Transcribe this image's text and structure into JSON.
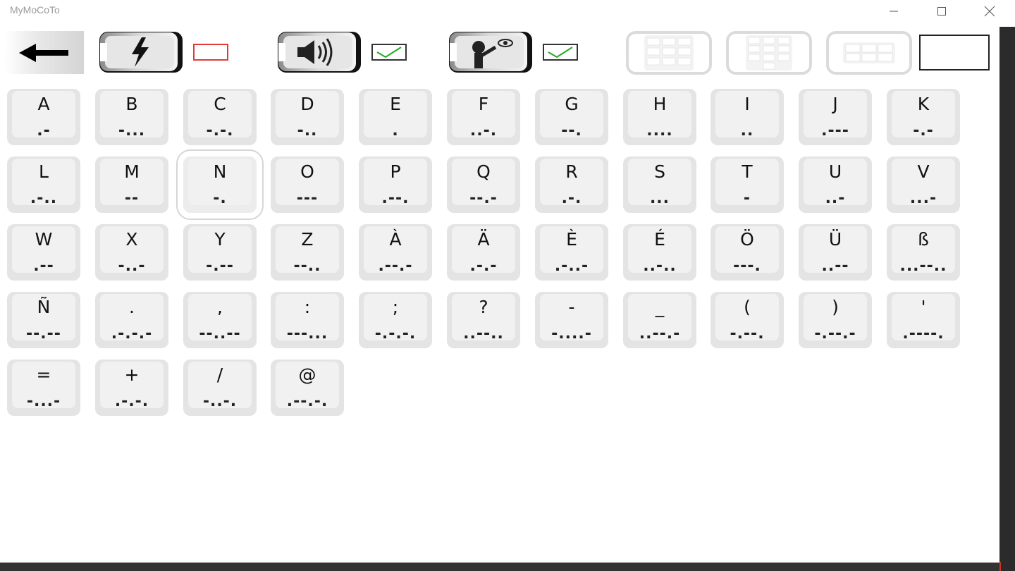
{
  "window": {
    "title": "MyMoCoTo"
  },
  "toolbar": {
    "back_icon": "left-arrow-icon",
    "flash_toggle_icon": "lightning-icon",
    "flash_checked": false,
    "sound_toggle_icon": "speaker-icon",
    "sound_checked": true,
    "visual_toggle_icon": "person-eye-icon",
    "visual_checked": true,
    "layout_icons": [
      "abc-keypad-icon",
      "numeric-keypad-icon",
      "arrow-keypad-icon"
    ],
    "colors": {
      "unchecked_border": "#e23a3a",
      "check_mark": "#22a822"
    }
  },
  "keys": [
    {
      "letter": "A",
      "code": ".-"
    },
    {
      "letter": "B",
      "code": "-..."
    },
    {
      "letter": "C",
      "code": "-.-."
    },
    {
      "letter": "D",
      "code": "-.."
    },
    {
      "letter": "E",
      "code": "."
    },
    {
      "letter": "F",
      "code": "..-."
    },
    {
      "letter": "G",
      "code": "--."
    },
    {
      "letter": "H",
      "code": "...."
    },
    {
      "letter": "I",
      "code": ".."
    },
    {
      "letter": "J",
      "code": ".---"
    },
    {
      "letter": "K",
      "code": "-.-"
    },
    {
      "letter": "L",
      "code": ".-.."
    },
    {
      "letter": "M",
      "code": "--"
    },
    {
      "letter": "N",
      "code": "-."
    },
    {
      "letter": "O",
      "code": "---"
    },
    {
      "letter": "P",
      "code": ".--."
    },
    {
      "letter": "Q",
      "code": "--.-"
    },
    {
      "letter": "R",
      "code": ".-."
    },
    {
      "letter": "S",
      "code": "..."
    },
    {
      "letter": "T",
      "code": "-"
    },
    {
      "letter": "U",
      "code": "..-"
    },
    {
      "letter": "V",
      "code": "...-"
    },
    {
      "letter": "W",
      "code": ".--"
    },
    {
      "letter": "X",
      "code": "-..-"
    },
    {
      "letter": "Y",
      "code": "-.--"
    },
    {
      "letter": "Z",
      "code": "--.."
    },
    {
      "letter": "À",
      "code": ".--.-"
    },
    {
      "letter": "Ä",
      "code": ".-.-"
    },
    {
      "letter": "È",
      "code": ".-..-"
    },
    {
      "letter": "É",
      "code": "..-.."
    },
    {
      "letter": "Ö",
      "code": "---."
    },
    {
      "letter": "Ü",
      "code": "..--"
    },
    {
      "letter": "ß",
      "code": "...--.."
    },
    {
      "letter": "Ñ",
      "code": "--.--"
    },
    {
      "letter": ".",
      "code": ".-.-.-"
    },
    {
      "letter": ",",
      "code": "--..--"
    },
    {
      "letter": ":",
      "code": "---..."
    },
    {
      "letter": ";",
      "code": "-.-.-."
    },
    {
      "letter": "?",
      "code": "..--.."
    },
    {
      "letter": "-",
      "code": "-....-"
    },
    {
      "letter": "_",
      "code": "..--.-"
    },
    {
      "letter": "(",
      "code": "-.--."
    },
    {
      "letter": ")",
      "code": "-.--.-"
    },
    {
      "letter": "'",
      "code": ".----."
    },
    {
      "letter": "=",
      "code": "-...-"
    },
    {
      "letter": "+",
      "code": ".-.-."
    },
    {
      "letter": "/",
      "code": "-..-."
    },
    {
      "letter": "@",
      "code": ".--.-."
    }
  ],
  "focused_key": "N"
}
